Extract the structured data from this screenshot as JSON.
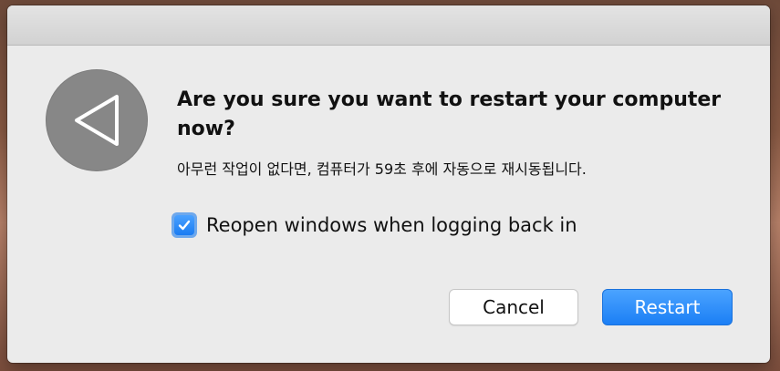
{
  "dialog": {
    "title": "Are you sure you want to restart your computer now?",
    "message": "아무런 작업이 없다면, 컴퓨터가 59초 후에 자동으로 재시동됩니다.",
    "countdown_seconds": 59,
    "icon": "restart-triangle-icon",
    "checkbox": {
      "label": "Reopen windows when logging back in",
      "checked": true
    },
    "buttons": {
      "cancel_label": "Cancel",
      "restart_label": "Restart"
    },
    "colors": {
      "accent": "#1b7ff5",
      "icon_circle": "#878787",
      "dialog_bg": "#ebebeb"
    }
  }
}
